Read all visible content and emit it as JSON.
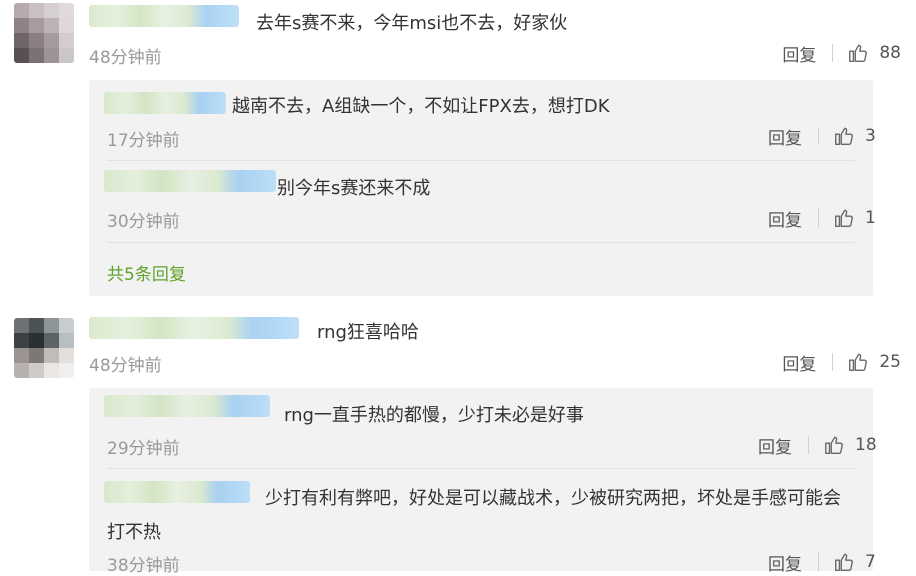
{
  "comments": [
    {
      "text": "去年s赛不来，今年msi也不去，好家伙",
      "time": "48分钟前",
      "reply_label": "回复",
      "likes": "88",
      "avatar_colors": [
        "#b8a9ad",
        "#c8c0c3",
        "#d6cfd2",
        "#e0dadd",
        "#8f8186",
        "#a99a9f",
        "#bdb2b6",
        "#ded8da",
        "#6f6468",
        "#8a7e82",
        "#a59a9e",
        "#d3cdd0",
        "#5a5054",
        "#7b7074",
        "#9d9397",
        "#cbc6c8"
      ],
      "replies": [
        {
          "text": "越南不去，A组缺一个，不如让FPX去，想打DK",
          "time": "17分钟前",
          "reply_label": "回复",
          "likes": "3"
        },
        {
          "text": "别今年s赛还来不成",
          "time": "30分钟前",
          "reply_label": "回复",
          "likes": "1"
        }
      ],
      "more_label": "共5条回复"
    },
    {
      "text": "rng狂喜哈哈",
      "time": "48分钟前",
      "reply_label": "回复",
      "likes": "25",
      "avatar_colors": [
        "#6d7274",
        "#4c5256",
        "#8e9598",
        "#c9cdcf",
        "#3b4145",
        "#2a2f33",
        "#5d6468",
        "#b9bec1",
        "#9c9490",
        "#7e7874",
        "#c2bcb8",
        "#e2dfdc",
        "#b7b1ad",
        "#d0cbc7",
        "#e9e6e3",
        "#f1efed"
      ],
      "replies": [
        {
          "text": "rng一直手热的都慢，少打未必是好事",
          "time": "29分钟前",
          "reply_label": "回复",
          "likes": "18"
        },
        {
          "text_line1": "少打有利有弊吧，好处是可以藏战术，少被研究两把，坏处是手感可能会",
          "text_line2": "打不热",
          "time": "38分钟前",
          "reply_label": "回复",
          "likes": "7"
        }
      ]
    }
  ]
}
